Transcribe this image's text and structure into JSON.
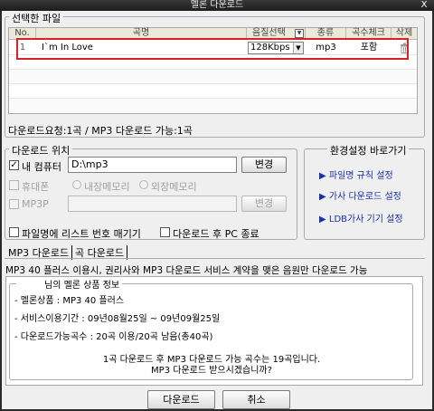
{
  "window": {
    "title": "멜론 다운로드",
    "close_label": "X"
  },
  "selected_files": {
    "group_title": "선택한 파일",
    "columns": [
      "No.",
      "곡명",
      "음질선택",
      "종류",
      "곡수체크",
      "삭제"
    ],
    "rows": [
      {
        "no": "1",
        "title": "I`m In Love",
        "quality": "128Kbps",
        "type": "mp3",
        "check": "포함"
      }
    ],
    "summary": "다운로드요청:1곡 / MP3 다운로드 가능:1곡"
  },
  "location": {
    "group_title": "다운로드 위치",
    "my_computer_label": "내 컴퓨터",
    "my_computer_path": "D:\\mp3",
    "change_label": "변경",
    "phone_label": "휴대폰",
    "internal_memory": "내장메모리",
    "external_memory": "외장메모리",
    "mp3p_label": "MP3P",
    "mp3p_change_label": "변경",
    "list_number_label": "파일명에 리스트 번호 매기기",
    "shutdown_label": "다운로드 후 PC 종료"
  },
  "settings": {
    "group_title": "환경설정 바로가기",
    "links": [
      "파일명 규칙 설정",
      "가사 다운로드 설정",
      "LDB가사 기기 설정"
    ]
  },
  "tabs": [
    "MP3 다운로드",
    "곡 다운로드"
  ],
  "notice": "MP3 40 플러스 이용시, 권리사와 MP3 다운로드 서비스 계약을 맺은 음원만 다운로드 가능",
  "product": {
    "group_title": "님의 멜론 상품 정보",
    "lines": [
      "- 멜론상품 : MP3 40 플러스",
      "- 서비스이용기간 : 09년08월25일 ~ 09년09월25일",
      "- 다운로드가능곡수 : 20곡 이용/20곡 남음(총40곡)"
    ],
    "message_line1": "1곡 다운로드 후 MP3 다운로드 가능 곡수는 19곡입니다.",
    "message_line2": "MP3 다운로드 받으시겠습니까?"
  },
  "buttons": {
    "download": "다운로드",
    "cancel": "취소"
  },
  "colors": {
    "highlight_border": "#d8222a",
    "link": "#1a2fa8",
    "titlebar": "#262626"
  }
}
